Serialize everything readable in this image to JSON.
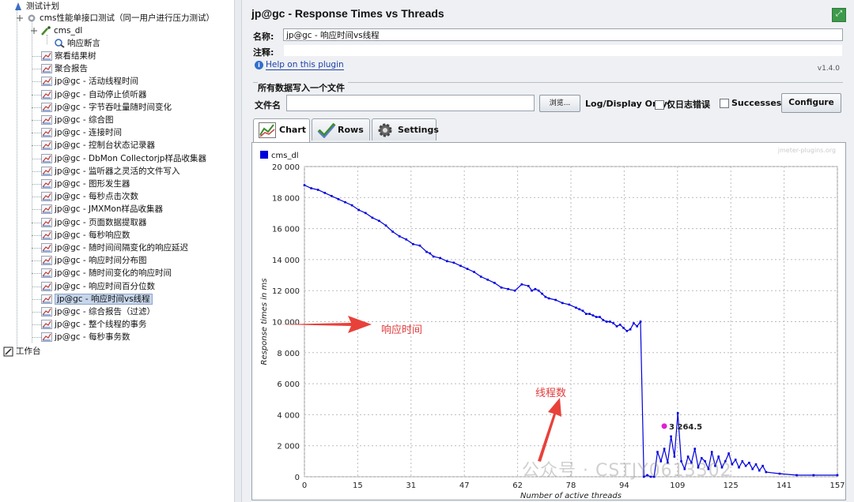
{
  "tree": {
    "root": "测试计划",
    "group": "cms性能单接口测试（同一用户进行压力测试）",
    "sampler": "cms_dl",
    "assertion": "响应断言",
    "listeners": [
      "察看结果树",
      "聚合报告",
      "jp@gc - 活动线程时间",
      "jp@gc - 自动停止侦听器",
      "jp@gc - 字节吞吐量随时间变化",
      "jp@gc - 综合图",
      "jp@gc - 连接时间",
      "jp@gc - 控制台状态记录器",
      "jp@gc - DbMon Collectorjp样品收集器",
      "jp@gc - 监听器之灵活的文件写入",
      "jp@gc - 图形发生器",
      "jp@gc - 每秒点击次数",
      "jp@gc - JMXMon样品收集器",
      "jp@gc - 页面数据提取器",
      "jp@gc - 每秒响应数",
      "jp@gc - 随时间间隔变化的响应延迟",
      "jp@gc - 响应时间分布图",
      "jp@gc - 随时间变化的响应时间",
      "jp@gc - 响应时间百分位数",
      "jp@gc - 响应时间vs线程",
      "jp@gc - 综合报告（过滤）",
      "jp@gc - 整个线程的事务",
      "jp@gc - 每秒事务数"
    ],
    "selected_index": 19,
    "workbench": "工作台"
  },
  "panel": {
    "title": "jp@gc - Response Times vs Threads",
    "name_label": "名称:",
    "name_value": "jp@gc - 响应时间vs线程",
    "comment_label": "注释:",
    "comment_value": "",
    "help_link": "Help on this plugin",
    "version": "v1.4.0",
    "file_group_title": "所有数据写入一个文件",
    "filename_label": "文件名",
    "filename_value": "",
    "browse_label": "浏览...",
    "log_display_label": "Log/Display Only:",
    "errors_only_label": "仅日志错误",
    "successes_label": "Successes",
    "configure_label": "Configure",
    "tabs": [
      "Chart",
      "Rows",
      "Settings"
    ]
  },
  "annotations": {
    "response_time": "响应时间",
    "threads": "线程数"
  },
  "watermark": "公众号 · CSTJY0613302",
  "chart_data": {
    "type": "line",
    "watermark": "jmeter-plugins.org",
    "legend": [
      "cms_dl"
    ],
    "legend_position": "top-left",
    "series_color": "#0000dd",
    "ylabel": "Response times in ms",
    "xlabel": "Number of active threads",
    "ylim": [
      0,
      20000
    ],
    "xlim": [
      0,
      157
    ],
    "yticks": [
      "0",
      "2 000",
      "4 000",
      "6 000",
      "8 000",
      "10 000",
      "12 000",
      "14 000",
      "16 000",
      "18 000",
      "20 000"
    ],
    "xticks": [
      "0",
      "15",
      "31",
      "47",
      "62",
      "78",
      "94",
      "109",
      "125",
      "141",
      "157"
    ],
    "grid": true,
    "point_label": {
      "x": 106,
      "y": 3264.5,
      "text": "3 264.5",
      "color": "#e020d0"
    },
    "series": [
      {
        "name": "cms_dl",
        "x": [
          0,
          2,
          4,
          6,
          8,
          10,
          12,
          14,
          16,
          18,
          20,
          22,
          24,
          26,
          28,
          30,
          32,
          34,
          36,
          37,
          38,
          40,
          42,
          44,
          46,
          48,
          50,
          52,
          54,
          56,
          58,
          60,
          62,
          64,
          66,
          67,
          68,
          69,
          70,
          71,
          72,
          74,
          76,
          78,
          80,
          81,
          82,
          83,
          84,
          85,
          86,
          87,
          88,
          89,
          90,
          91,
          92,
          93,
          94,
          95,
          96,
          97,
          98,
          99,
          100,
          101,
          102,
          103,
          104,
          105,
          106,
          107,
          108,
          109,
          110,
          111,
          112,
          113,
          114,
          115,
          116,
          117,
          118,
          119,
          120,
          121,
          122,
          123,
          124,
          125,
          126,
          127,
          128,
          129,
          130,
          131,
          132,
          133,
          134,
          135,
          136,
          140,
          145,
          150,
          157
        ],
        "y": [
          18800,
          18600,
          18500,
          18300,
          18100,
          17900,
          17700,
          17500,
          17200,
          17000,
          16700,
          16500,
          16200,
          15800,
          15500,
          15300,
          15000,
          14900,
          14500,
          14400,
          14200,
          14100,
          13900,
          13800,
          13600,
          13400,
          13200,
          12900,
          12700,
          12500,
          12200,
          12100,
          12000,
          12400,
          12300,
          12000,
          12100,
          12000,
          11800,
          11600,
          11500,
          11400,
          11200,
          11100,
          10900,
          10800,
          10700,
          10500,
          10500,
          10400,
          10300,
          10300,
          10100,
          10000,
          10000,
          9900,
          9700,
          9800,
          9600,
          9400,
          9500,
          9900,
          9700,
          10000,
          0,
          100,
          0,
          0,
          1600,
          1000,
          1800,
          900,
          2600,
          1300,
          4100,
          1000,
          500,
          1300,
          900,
          1800,
          600,
          1200,
          1000,
          500,
          1600,
          700,
          1300,
          600,
          1000,
          1500,
          800,
          1100,
          600,
          1000,
          700,
          900,
          500,
          800,
          400,
          700,
          300,
          200,
          100,
          100,
          100
        ]
      }
    ]
  }
}
